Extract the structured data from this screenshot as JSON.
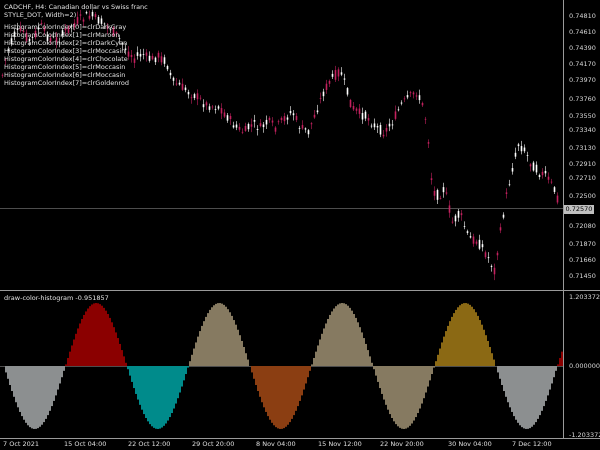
{
  "chart": {
    "symbol_line": "CADCHF, H4: Canadian dollar vs Swiss franc",
    "style_line": "STYLE_DOT, Width=2)",
    "color_lines": [
      "HistogramColorIndex[0]=clrDarkGray",
      "HistogramColorIndex[1]=clrMaroon",
      "HistogramColorIndex[2]=clrDarkCyan",
      "HistogramColorIndex[3]=clrMoccasin",
      "HistogramColorIndex[4]=clrChocolate",
      "HistogramColorIndex[5]=clrMoccasin",
      "HistogramColorIndex[6]=clrMoccasin",
      "HistogramColorIndex[7]=clrGoldenrod"
    ],
    "current_price": "0.72570",
    "price_labels": [
      "0.74810",
      "0.74610",
      "0.74390",
      "0.74170",
      "0.73970",
      "0.73760",
      "0.73550",
      "0.73340",
      "0.73130",
      "0.72910",
      "0.72710",
      "0.72500",
      "0.72080",
      "0.71870",
      "0.71660",
      "0.71450"
    ]
  },
  "indicator": {
    "title": "draw-color-histogram -0.951857",
    "scale": [
      "1.203372",
      "0.000000",
      "-1.203372"
    ]
  },
  "time_axis": [
    "7 Oct 2021",
    "15 Oct 04:00",
    "22 Oct 12:00",
    "29 Oct 20:00",
    "8 Nov 04:00",
    "15 Nov 12:00",
    "22 Nov 20:00",
    "30 Nov 04:00",
    "7 Dec 12:00"
  ],
  "colors": {
    "background": "#000000",
    "bull_candle": "#ffffff",
    "bear_candle": "#c3215e",
    "grid": "#9a9a9a",
    "histogram": [
      "#8c8f90",
      "#8b0000",
      "#008b8b",
      "#867a61",
      "#8b3e12",
      "#867a61",
      "#867a61",
      "#8b6914"
    ]
  }
}
